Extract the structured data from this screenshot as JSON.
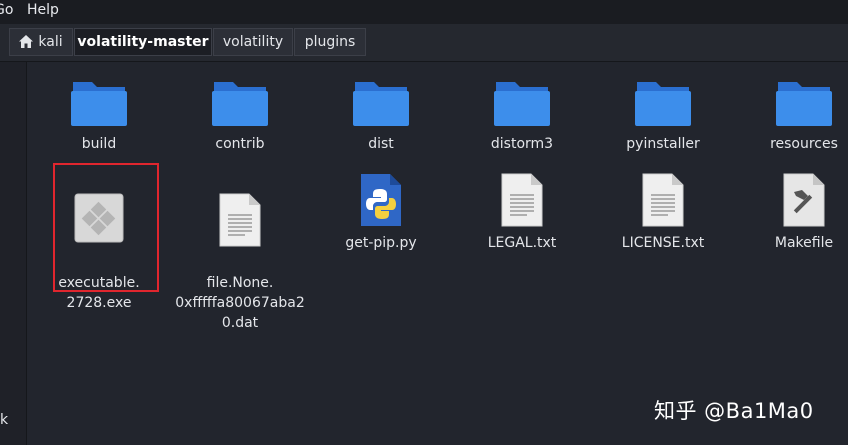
{
  "menubar": {
    "items": [
      "Go",
      "Help"
    ]
  },
  "pathbar": {
    "crumbs": [
      {
        "label": "kali"
      },
      {
        "label": "volatility-master"
      },
      {
        "label": "volatility"
      },
      {
        "label": "plugins"
      }
    ]
  },
  "sidebar": {
    "visible_text": "k"
  },
  "files": [
    {
      "name": "build",
      "icon": "folder-icon"
    },
    {
      "name": "contrib",
      "icon": "folder-icon"
    },
    {
      "name": "dist",
      "icon": "folder-icon"
    },
    {
      "name": "distorm3",
      "icon": "folder-icon"
    },
    {
      "name": "pyinstaller",
      "icon": "folder-icon"
    },
    {
      "name": "resources",
      "icon": "folder-icon"
    },
    {
      "name": "executable.\n2728.exe",
      "icon": "executable-icon"
    },
    {
      "name": "file.None.\n0xfffffa80067aba2\n0.dat",
      "icon": "text-file-icon"
    },
    {
      "name": "get-pip.py",
      "icon": "python-file-icon"
    },
    {
      "name": "LEGAL.txt",
      "icon": "text-file-icon"
    },
    {
      "name": "LICENSE.txt",
      "icon": "text-file-icon"
    },
    {
      "name": "Makefile",
      "icon": "makefile-icon"
    }
  ],
  "watermark": "知乎 @Ba1Ma0",
  "colors": {
    "background": "#22252d",
    "folder": "#3d8eeb",
    "selection_border": "#e0262e"
  }
}
